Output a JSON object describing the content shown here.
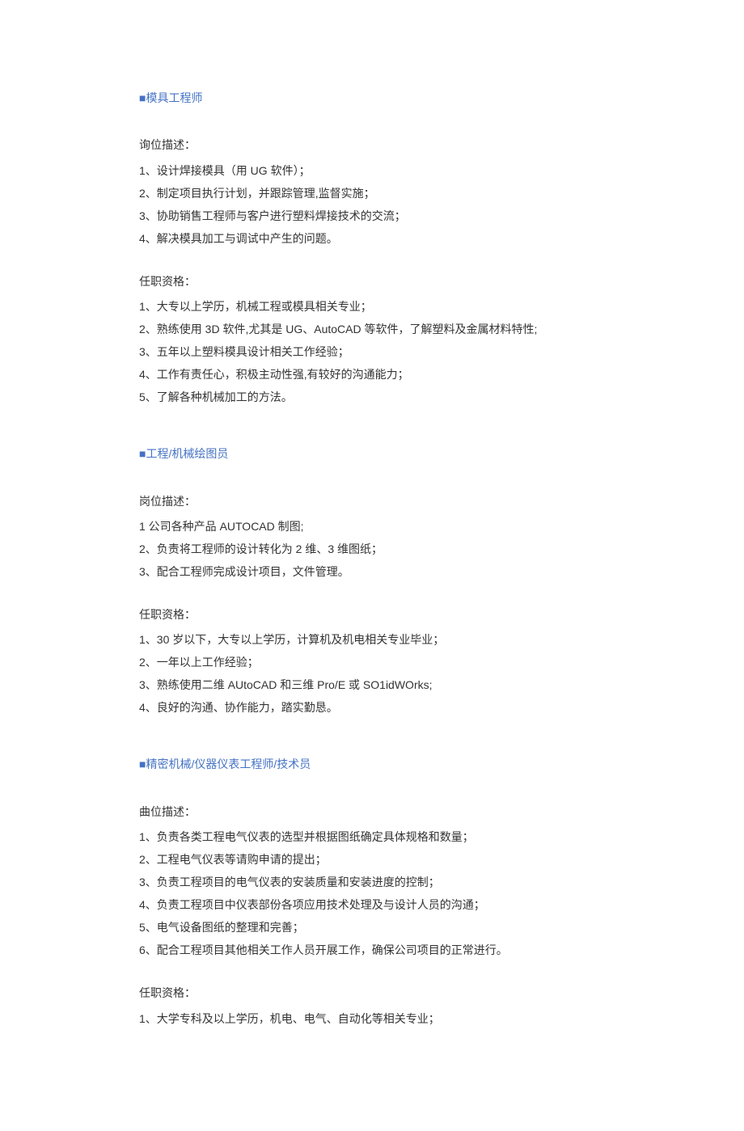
{
  "jobs": [
    {
      "marker": "■",
      "title": "模具工程师",
      "description_label": "询位描述：",
      "description_items": [
        "1、设计焊接模具（用 UG 软件）；",
        "2、制定项目执行计划，并跟踪管理,监督实施；",
        "3、协助销售工程师与客户进行塑料焊接技术的交流；",
        "4、解决模具加工与调试中产生的问题。"
      ],
      "qualification_label": "任职资格：",
      "qualification_items": [
        "1、大专以上学历，机械工程或模具相关专业；",
        "2、熟练使用 3D 软件,尤其是 UG、AutoCAD 等软件，了解塑料及金属材料特性;",
        "3、五年以上塑料模具设计相关工作经验；",
        "4、工作有责任心，积极主动性强,有较好的沟通能力；",
        "5、了解各种机械加工的方法。"
      ]
    },
    {
      "marker": "■",
      "title": "工程/机械绘图员",
      "description_label": "岗位描述：",
      "description_items": [
        "1 公司各种产品 AUTOCAD 制图;",
        "2、负责将工程师的设计转化为 2 维、3 维图纸；",
        "3、配合工程师完成设计项目，文件管理。"
      ],
      "qualification_label": "任职资格：",
      "qualification_items": [
        "1、30 岁以下，大专以上学历，计算机及机电相关专业毕业；",
        "2、一年以上工作经验；",
        "3、熟练使用二维 AUtoCAD 和三维 Pro/E 或 SO1idWOrks;",
        "4、良好的沟通、协作能力，踏实勤恳。"
      ]
    },
    {
      "marker": "■",
      "title": "精密机械/仪器仪表工程师/技术员",
      "description_label": "曲位描述：",
      "description_items": [
        "1、负责各类工程电气仪表的选型并根据图纸确定具体规格和数量；",
        "2、工程电气仪表等请购申请的提出；",
        "3、负责工程项目的电气仪表的安装质量和安装进度的控制；",
        "4、负责工程项目中仪表部份各项应用技术处理及与设计人员的沟通；",
        "5、电气设备图纸的整理和完善；",
        "6、配合工程项目其他相关工作人员开展工作，确保公司项目的正常进行。"
      ],
      "qualification_label": "任职资格：",
      "qualification_items": [
        "1、大学专科及以上学历，机电、电气、自动化等相关专业；"
      ]
    }
  ]
}
